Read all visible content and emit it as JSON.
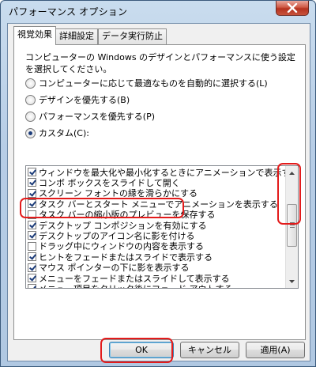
{
  "window": {
    "title": "パフォーマンス オプション"
  },
  "tabs": [
    {
      "label": "視覚効果"
    },
    {
      "label": "詳細設定"
    },
    {
      "label": "データ実行防止"
    }
  ],
  "description": "コンピューターの Windows のデザインとパフォーマンスに使う設定を選択してください。",
  "radios": [
    {
      "label": "コンピューターに応じて最適なものを自動的に選択する(L)",
      "checked": false
    },
    {
      "label": "デザインを優先する(B)",
      "checked": false
    },
    {
      "label": "パフォーマンスを優先する(P)",
      "checked": false
    },
    {
      "label": "カスタム(C):",
      "checked": true
    }
  ],
  "options": [
    {
      "label": "ウィンドウを最大化や最小化するときにアニメーションで表示する",
      "checked": true
    },
    {
      "label": "コンボ ボックスをスライドして開く",
      "checked": true
    },
    {
      "label": "スクリーン フォントの縁を滑らかにする",
      "checked": true
    },
    {
      "label": "タスク バーとスタート メニューでアニメーションを表示する",
      "checked": true
    },
    {
      "label": "タスク バーの縮小版のプレビューを保存する",
      "checked": false
    },
    {
      "label": "デスクトップ コンポジションを有効にする",
      "checked": true
    },
    {
      "label": "デスクトップのアイコン名に影を付ける",
      "checked": true
    },
    {
      "label": "ドラッグ中にウィンドウの内容を表示する",
      "checked": false
    },
    {
      "label": "ヒントをフェードまたはスライドで表示する",
      "checked": true
    },
    {
      "label": "マウス ポインターの下に影を表示する",
      "checked": true
    },
    {
      "label": "メニューをフェードまたはスライドして表示する",
      "checked": true
    },
    {
      "label": "メニュー項目をクリック後にフェード アウトする",
      "checked": true
    }
  ],
  "buttons": {
    "ok": "OK",
    "cancel": "キャンセル",
    "apply": "適用(A)"
  },
  "colors": {
    "highlight": "#e31b1b",
    "check_mark": "#1c3c7a"
  }
}
